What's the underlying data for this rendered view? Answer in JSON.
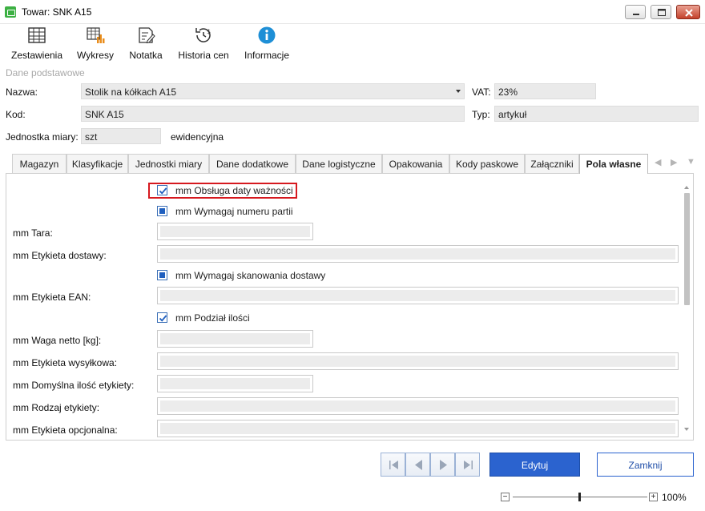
{
  "window": {
    "title": "Towar: SNK A15"
  },
  "toolbar": [
    {
      "label": "Zestawienia",
      "icon": "table-icon"
    },
    {
      "label": "Wykresy",
      "icon": "chart-icon"
    },
    {
      "label": "Notatka",
      "icon": "note-icon"
    },
    {
      "label": "Historia cen",
      "icon": "price-history-icon"
    },
    {
      "label": "Informacje",
      "icon": "info-icon"
    }
  ],
  "basic": {
    "section_title": "Dane podstawowe",
    "nazwa_label": "Nazwa:",
    "nazwa_value": "Stolik na kółkach A15",
    "vat_label": "VAT:",
    "vat_value": "23%",
    "kod_label": "Kod:",
    "kod_value": "SNK A15",
    "typ_label": "Typ:",
    "typ_value": "artykuł",
    "jm_label": "Jednostka miary:",
    "jm_value": "szt",
    "jm_note": "ewidencyjna"
  },
  "tabs": [
    {
      "label": "Magazyn"
    },
    {
      "label": "Klasyfikacje"
    },
    {
      "label": "Jednostki miary"
    },
    {
      "label": "Dane dodatkowe"
    },
    {
      "label": "Dane logistyczne"
    },
    {
      "label": "Opakowania"
    },
    {
      "label": "Kody paskowe"
    },
    {
      "label": "Załączniki"
    },
    {
      "label": "Pola własne",
      "active": true
    }
  ],
  "fields": {
    "obsluga_daty": "mm Obsługa daty ważności",
    "wymagaj_partii": "mm Wymagaj numeru partii",
    "tara": "mm Tara:",
    "etykieta_dostawy": "mm Etykieta dostawy:",
    "wymagaj_skanowania": "mm Wymagaj skanowania dostawy",
    "etykieta_ean": "mm Etykieta EAN:",
    "podzial_ilosci": "mm Podział ilości",
    "waga_netto": "mm Waga netto [kg]:",
    "etykieta_wysylkowa": "mm Etykieta wysyłkowa:",
    "domyslna_ilosc": "mm Domyślna ilość etykiety:",
    "rodzaj_etykiety": "mm Rodzaj etykiety:",
    "etykieta_opcjonalna": "mm Etykieta opcjonalna:"
  },
  "checkbox_states": {
    "obsluga_daty": "checked",
    "wymagaj_partii": "indeterminate",
    "wymagaj_skanowania": "indeterminate",
    "podzial_ilosci": "checked"
  },
  "buttons": {
    "edit": "Edytuj",
    "close": "Zamknij"
  },
  "zoom": {
    "label": "100%",
    "minus": "−",
    "plus": "+"
  },
  "colors": {
    "accent": "#2b63cf",
    "highlight": "#d6191f"
  }
}
